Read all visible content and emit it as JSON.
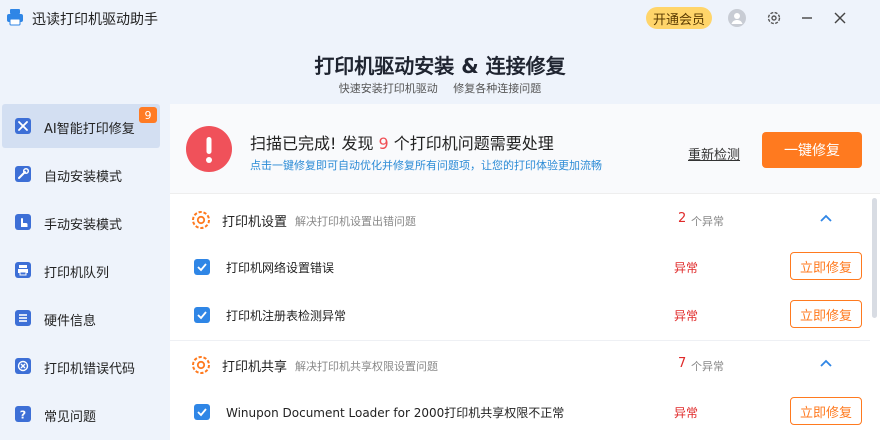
{
  "app": {
    "title": "迅读打印机驱动助手",
    "vip_label": "开通会员"
  },
  "titlebar_icons": [
    "user-icon",
    "gear-icon",
    "minimize-icon",
    "close-icon"
  ],
  "hero": {
    "title": "打印机驱动安装 & 连接修复",
    "sub_left": "快速安装打印机驱动",
    "sub_right": "修复各种连接问题"
  },
  "sidebar": {
    "items": [
      {
        "label": "AI智能打印修复",
        "icon": "wrench-screwdriver-icon",
        "badge": "9",
        "active": true
      },
      {
        "label": "自动安装模式",
        "icon": "wrench-icon"
      },
      {
        "label": "手动安装模式",
        "icon": "hand-pointer-icon"
      },
      {
        "label": "打印机队列",
        "icon": "printer-icon"
      },
      {
        "label": "硬件信息",
        "icon": "list-icon"
      },
      {
        "label": "打印机错误代码",
        "icon": "error-x-icon"
      },
      {
        "label": "常见问题",
        "icon": "question-icon"
      }
    ]
  },
  "banner": {
    "title_pre": "扫描已完成! 发现",
    "issue_count": "9",
    "title_post": "个打印机问题需要处理",
    "desc": "点击一键修复即可自动优化并修复所有问题项，让您的打印体验更加流畅",
    "rescan_label": "重新检测",
    "fix_all_label": "一键修复"
  },
  "groups": [
    {
      "name": "打印机设置",
      "desc": "解决打印机设置出错问题",
      "count": "2",
      "count_unit": "个异常",
      "rows": [
        {
          "label": "打印机网络设置错误",
          "status": "异常",
          "action": "立即修复"
        },
        {
          "label": "打印机注册表检测异常",
          "status": "异常",
          "action": "立即修复"
        }
      ]
    },
    {
      "name": "打印机共享",
      "desc": "解决打印机共享权限设置问题",
      "count": "7",
      "count_unit": "个异常",
      "rows": [
        {
          "label": "Winupon Document Loader for 2000打印机共享权限不正常",
          "status": "异常",
          "action": "立即修复"
        }
      ]
    }
  ],
  "colors": {
    "accent_orange": "#ff7a1f",
    "alert_red": "#f0515a",
    "link_blue": "#2b8bd6",
    "checkbox_blue": "#2f86e6",
    "vip_yellow": "#ffd56a"
  }
}
